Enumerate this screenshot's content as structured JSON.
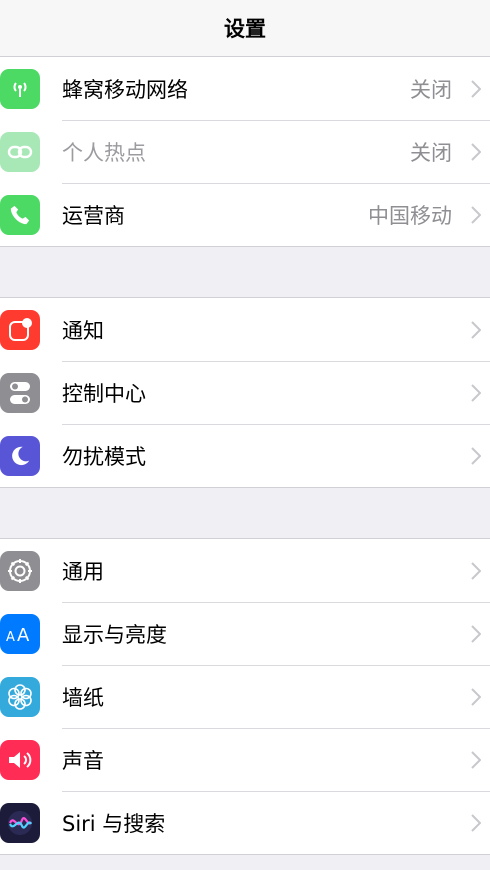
{
  "header": {
    "title": "设置"
  },
  "groups": [
    {
      "items": [
        {
          "label": "蜂窝移动网络",
          "detail": "关闭",
          "icon": "antenna-icon",
          "color": "#4cd964"
        },
        {
          "label": "个人热点",
          "detail": "关闭",
          "icon": "hotspot-link-icon",
          "color": "#a8e8b6"
        },
        {
          "label": "运营商",
          "detail": "中国移动",
          "icon": "phone-icon",
          "color": "#4cd964"
        }
      ]
    },
    {
      "items": [
        {
          "label": "通知",
          "icon": "notification-icon",
          "color": "#ff3b30"
        },
        {
          "label": "控制中心",
          "icon": "toggles-icon",
          "color": "#8e8e93"
        },
        {
          "label": "勿扰模式",
          "icon": "moon-icon",
          "color": "#5856d6"
        }
      ]
    },
    {
      "items": [
        {
          "label": "通用",
          "icon": "gear-icon",
          "color": "#8e8e93"
        },
        {
          "label": "显示与亮度",
          "icon": "text-size-icon",
          "color": "#007aff"
        },
        {
          "label": "墙纸",
          "icon": "flower-icon",
          "color": "#34aadc"
        },
        {
          "label": "声音",
          "icon": "speaker-icon",
          "color": "#ff2d55"
        },
        {
          "label": "Siri 与搜索",
          "icon": "siri-icon",
          "color": "#1c1c3a"
        }
      ]
    }
  ],
  "icons": {
    "chevron": "chevron-right-icon"
  }
}
